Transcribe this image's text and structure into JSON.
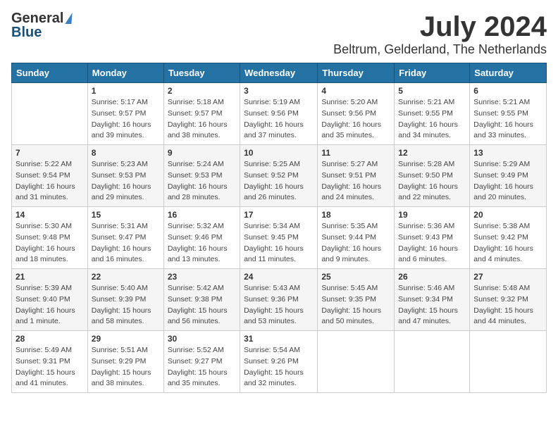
{
  "header": {
    "logo_general": "General",
    "logo_blue": "Blue",
    "month_title": "July 2024",
    "location": "Beltrum, Gelderland, The Netherlands"
  },
  "calendar": {
    "days_of_week": [
      "Sunday",
      "Monday",
      "Tuesday",
      "Wednesday",
      "Thursday",
      "Friday",
      "Saturday"
    ],
    "weeks": [
      [
        {
          "day": "",
          "info": ""
        },
        {
          "day": "1",
          "info": "Sunrise: 5:17 AM\nSunset: 9:57 PM\nDaylight: 16 hours\nand 39 minutes."
        },
        {
          "day": "2",
          "info": "Sunrise: 5:18 AM\nSunset: 9:57 PM\nDaylight: 16 hours\nand 38 minutes."
        },
        {
          "day": "3",
          "info": "Sunrise: 5:19 AM\nSunset: 9:56 PM\nDaylight: 16 hours\nand 37 minutes."
        },
        {
          "day": "4",
          "info": "Sunrise: 5:20 AM\nSunset: 9:56 PM\nDaylight: 16 hours\nand 35 minutes."
        },
        {
          "day": "5",
          "info": "Sunrise: 5:21 AM\nSunset: 9:55 PM\nDaylight: 16 hours\nand 34 minutes."
        },
        {
          "day": "6",
          "info": "Sunrise: 5:21 AM\nSunset: 9:55 PM\nDaylight: 16 hours\nand 33 minutes."
        }
      ],
      [
        {
          "day": "7",
          "info": "Sunrise: 5:22 AM\nSunset: 9:54 PM\nDaylight: 16 hours\nand 31 minutes."
        },
        {
          "day": "8",
          "info": "Sunrise: 5:23 AM\nSunset: 9:53 PM\nDaylight: 16 hours\nand 29 minutes."
        },
        {
          "day": "9",
          "info": "Sunrise: 5:24 AM\nSunset: 9:53 PM\nDaylight: 16 hours\nand 28 minutes."
        },
        {
          "day": "10",
          "info": "Sunrise: 5:25 AM\nSunset: 9:52 PM\nDaylight: 16 hours\nand 26 minutes."
        },
        {
          "day": "11",
          "info": "Sunrise: 5:27 AM\nSunset: 9:51 PM\nDaylight: 16 hours\nand 24 minutes."
        },
        {
          "day": "12",
          "info": "Sunrise: 5:28 AM\nSunset: 9:50 PM\nDaylight: 16 hours\nand 22 minutes."
        },
        {
          "day": "13",
          "info": "Sunrise: 5:29 AM\nSunset: 9:49 PM\nDaylight: 16 hours\nand 20 minutes."
        }
      ],
      [
        {
          "day": "14",
          "info": "Sunrise: 5:30 AM\nSunset: 9:48 PM\nDaylight: 16 hours\nand 18 minutes."
        },
        {
          "day": "15",
          "info": "Sunrise: 5:31 AM\nSunset: 9:47 PM\nDaylight: 16 hours\nand 16 minutes."
        },
        {
          "day": "16",
          "info": "Sunrise: 5:32 AM\nSunset: 9:46 PM\nDaylight: 16 hours\nand 13 minutes."
        },
        {
          "day": "17",
          "info": "Sunrise: 5:34 AM\nSunset: 9:45 PM\nDaylight: 16 hours\nand 11 minutes."
        },
        {
          "day": "18",
          "info": "Sunrise: 5:35 AM\nSunset: 9:44 PM\nDaylight: 16 hours\nand 9 minutes."
        },
        {
          "day": "19",
          "info": "Sunrise: 5:36 AM\nSunset: 9:43 PM\nDaylight: 16 hours\nand 6 minutes."
        },
        {
          "day": "20",
          "info": "Sunrise: 5:38 AM\nSunset: 9:42 PM\nDaylight: 16 hours\nand 4 minutes."
        }
      ],
      [
        {
          "day": "21",
          "info": "Sunrise: 5:39 AM\nSunset: 9:40 PM\nDaylight: 16 hours\nand 1 minute."
        },
        {
          "day": "22",
          "info": "Sunrise: 5:40 AM\nSunset: 9:39 PM\nDaylight: 15 hours\nand 58 minutes."
        },
        {
          "day": "23",
          "info": "Sunrise: 5:42 AM\nSunset: 9:38 PM\nDaylight: 15 hours\nand 56 minutes."
        },
        {
          "day": "24",
          "info": "Sunrise: 5:43 AM\nSunset: 9:36 PM\nDaylight: 15 hours\nand 53 minutes."
        },
        {
          "day": "25",
          "info": "Sunrise: 5:45 AM\nSunset: 9:35 PM\nDaylight: 15 hours\nand 50 minutes."
        },
        {
          "day": "26",
          "info": "Sunrise: 5:46 AM\nSunset: 9:34 PM\nDaylight: 15 hours\nand 47 minutes."
        },
        {
          "day": "27",
          "info": "Sunrise: 5:48 AM\nSunset: 9:32 PM\nDaylight: 15 hours\nand 44 minutes."
        }
      ],
      [
        {
          "day": "28",
          "info": "Sunrise: 5:49 AM\nSunset: 9:31 PM\nDaylight: 15 hours\nand 41 minutes."
        },
        {
          "day": "29",
          "info": "Sunrise: 5:51 AM\nSunset: 9:29 PM\nDaylight: 15 hours\nand 38 minutes."
        },
        {
          "day": "30",
          "info": "Sunrise: 5:52 AM\nSunset: 9:27 PM\nDaylight: 15 hours\nand 35 minutes."
        },
        {
          "day": "31",
          "info": "Sunrise: 5:54 AM\nSunset: 9:26 PM\nDaylight: 15 hours\nand 32 minutes."
        },
        {
          "day": "",
          "info": ""
        },
        {
          "day": "",
          "info": ""
        },
        {
          "day": "",
          "info": ""
        }
      ]
    ]
  }
}
